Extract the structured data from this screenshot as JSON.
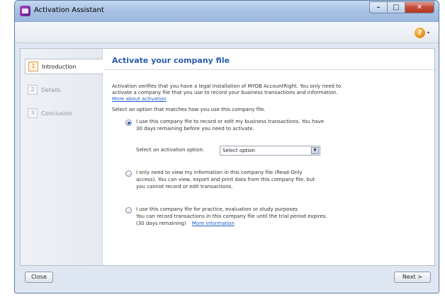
{
  "window": {
    "title": "Activation Assistant",
    "controls": {
      "minimize": "–",
      "maximize": "□",
      "close": "✕"
    }
  },
  "toolbar": {
    "help_icon": "?",
    "help_caret": "▾"
  },
  "steps": [
    {
      "number": "1",
      "label": "Introduction",
      "state": "active"
    },
    {
      "number": "2",
      "label": "Details",
      "state": "disabled"
    },
    {
      "number": "3",
      "label": "Conclusion",
      "state": "disabled"
    }
  ],
  "page": {
    "title": "Activate your company file",
    "intro_line1": "Activation verifies that you have a legal installation of MYOB AccountRight.  You only need to",
    "intro_line2": "activate a company file that you use to record your business transactions and information.",
    "intro_link": "More about activation",
    "select_prompt": "Select an option that matches how you use this company file."
  },
  "options": [
    {
      "line1": "I use this company file to record or edit my business transactions.  You have",
      "line2": "30 days remaining before you need to activate.",
      "checked": true
    },
    {
      "line1": "I only need to view my information in this company file (Read-Only",
      "line2": "access). You can view, export and print data from this company file, but",
      "line3": "you cannot record or edit transactions.",
      "checked": false
    },
    {
      "line1": "I use this company file for practice, evaluation or study purposes",
      "line2": "You can record transactions in this company file until the trial period expires.",
      "line3": "(30 days remaining)",
      "link": "More information",
      "checked": false
    }
  ],
  "activation_select": {
    "label": "Select an activation option:",
    "value": "Select option",
    "arrow": "▼"
  },
  "footer": {
    "close_label": "Close",
    "next_label": "Next >"
  },
  "colors": {
    "accent": "#2a5caa",
    "link": "#1f5fc9",
    "step_active": "#d07b10"
  }
}
